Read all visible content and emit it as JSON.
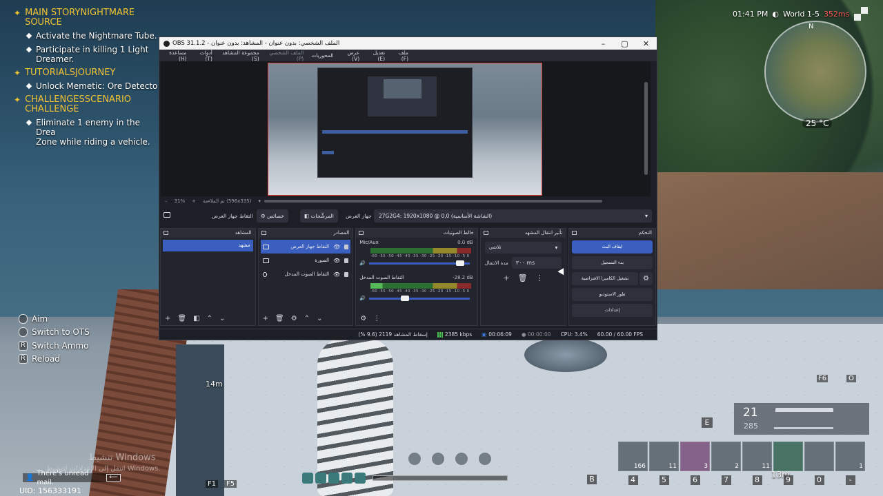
{
  "game": {
    "quests": [
      {
        "title": "MAIN STORYNIGHTMARE SOURCE",
        "items": [
          "Activate the Nightmare Tube.",
          "Participate in killing 1 Light\nDreamer."
        ]
      },
      {
        "title": "TUTORIALSJOURNEY",
        "items": [
          "Unlock Memetic: Ore Detecto"
        ]
      },
      {
        "title": "CHALLENGESSCENARIO CHALLENGE",
        "items": [
          "Eliminate 1 enemy in the Drea\nZone while riding a vehicle."
        ]
      }
    ],
    "controls": [
      {
        "key": "",
        "label": "Aim"
      },
      {
        "key": "",
        "label": "Switch to OTS"
      },
      {
        "key": "R",
        "label": "Switch Ammo"
      },
      {
        "key": "R",
        "label": "Reload"
      }
    ],
    "time": "01:41 PM",
    "world": "World 1-5",
    "ping": "352ms",
    "compass_n": "N",
    "temperature": "25 °C",
    "distance_left": "14m",
    "distance_right": "13m",
    "ammo": {
      "count": "21",
      "reserve": "285"
    },
    "key_e": "E",
    "key_b": "B",
    "key_f6": "F6",
    "key_o": "O",
    "hotbar_counts": [
      "166",
      "11",
      "3",
      "2",
      "11",
      "",
      "",
      "1"
    ],
    "hotbar_keys": [
      "4",
      "5",
      "6",
      "7",
      "8",
      "9",
      "0",
      "-"
    ],
    "windows_watermark_1": "تنشيط Windows",
    "windows_watermark_2": "انتقل إلى الإعدادات لتنشيط Windows.",
    "mail": "There's unread mail.",
    "uid": "UID: 156333191",
    "fkeys": [
      "F1",
      "F5"
    ]
  },
  "obs": {
    "title": "OBS 31.1.2 - الملف الشخصي: بدون عنوان - المشاهد: بدون عنوان",
    "menu": [
      "ملف (F)",
      "تعديل (E)",
      "عرض (V)",
      "المحوريات",
      "الملف الشخصي (P)",
      "مجموعة المشاهد (S)",
      "أدوات (T)",
      "مساعدة (H)"
    ],
    "zoom": "31%",
    "zoom_detail": "تم الملاءمة (596x335)",
    "source_toolbar": {
      "capture_label": "التقاط جهاز العرض",
      "properties": "خصائص",
      "filters": "المرشِّحات",
      "device_label": "جهاز العرض",
      "device_value": "27G2G4: 1920x1080 @ 0,0 (الشاشة الأساسية)"
    },
    "docks": {
      "scenes": {
        "title": "المشاهد",
        "items": [
          "مشهد"
        ]
      },
      "sources": {
        "title": "المصادر",
        "items": [
          "التقاط جهاز العرض",
          "الصورة",
          "التقاط الصوت المدخل"
        ]
      },
      "mixer": {
        "title": "خالط الصوتيات",
        "channels": [
          {
            "name": "Mic/Aux",
            "db": "0.0 dB",
            "volume": 0.95
          },
          {
            "name": "التقاط الصوت المدخل",
            "db": "-28.2 dB",
            "volume": 0.4
          }
        ],
        "scale": "-60 -55 -50 -45 -40 -35 -30 -25 -20 -15 -10 -5 0"
      },
      "transitions": {
        "title": "تأثير انتقال المشهد",
        "type": "تلاشي",
        "duration_label": "مدة الانتقال",
        "duration": "٣٠٠ ms"
      },
      "controls": {
        "title": "التحكم",
        "buttons": [
          "ايقاف البث",
          "بدء التسجيل",
          "تشغيل الكاميرا الافتراضية",
          "طور الاستوديو",
          "إعدادات"
        ]
      }
    },
    "status": {
      "dropped": "إسقاط المشاهد 2119 (9.6 %)",
      "bitrate": "2385 kbps",
      "stream_time": "00:06:09",
      "rec_time": "00:00:00",
      "cpu": "CPU: 3.4%",
      "fps": "60.00 / 60.00 FPS"
    }
  }
}
